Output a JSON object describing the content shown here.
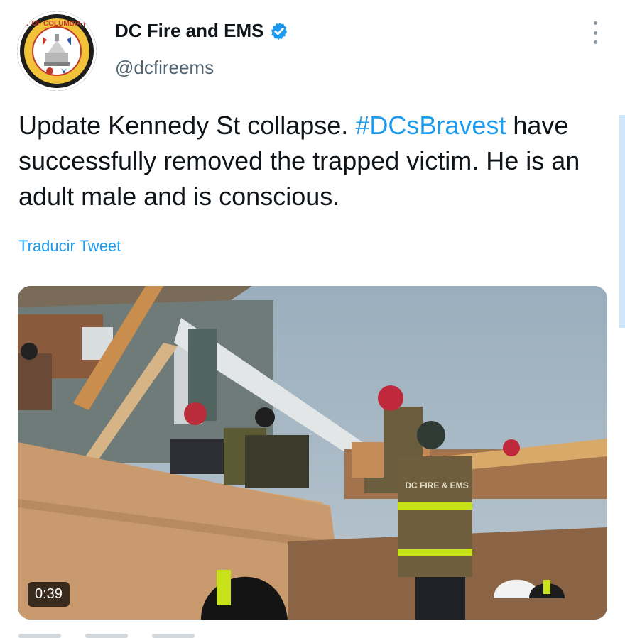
{
  "author": {
    "name": "DC Fire and EMS",
    "handle": "@dcfireems",
    "verified": true,
    "avatar_text": "DISTRICT OF COLUMBIA FIRE EMS"
  },
  "icons": {
    "verified": "verified-badge-icon",
    "more": "more-vertical-icon"
  },
  "tweet": {
    "text_before": "Update Kennedy St collapse. ",
    "hashtag": "#DCsBravest",
    "text_after": " have successfully removed the trapped victim. He is an adult male and is conscious."
  },
  "translate_label": "Traducir Tweet",
  "media": {
    "type": "video",
    "duration": "0:39",
    "jacket_text": "DC FIRE & EMS"
  },
  "colors": {
    "accent": "#1d9bf0",
    "text": "#0f1419",
    "secondary_text": "#536471"
  }
}
